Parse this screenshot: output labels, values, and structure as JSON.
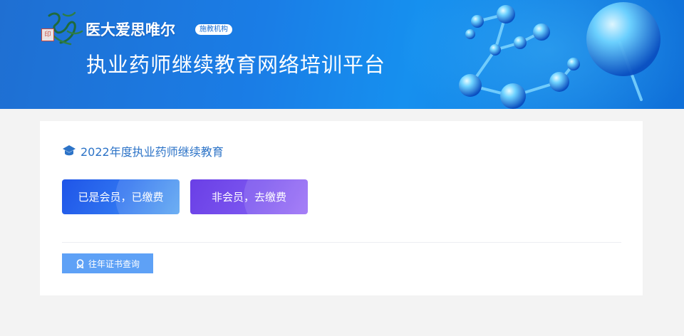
{
  "header": {
    "brand_name": "医大爱思唯尔",
    "brand_badge": "施教机构",
    "platform_title": "执业药师继续教育网络培训平台",
    "logo_icon": "brand-logo-calligraphy"
  },
  "main": {
    "section_title": "2022年度执业药师继续教育",
    "section_icon": "graduation-cap-icon",
    "member_button": "已是会员，已缴费",
    "nonmember_button": "非会员，去缴费",
    "cert_query_button": "往年证书查询",
    "cert_icon": "award-icon"
  },
  "colors": {
    "banner": "#1a7de6",
    "title_blue": "#2c73c7",
    "member_button": "#2f73f0",
    "nonmember_button": "#7b55ef",
    "cert_button": "#5ea1f6"
  }
}
